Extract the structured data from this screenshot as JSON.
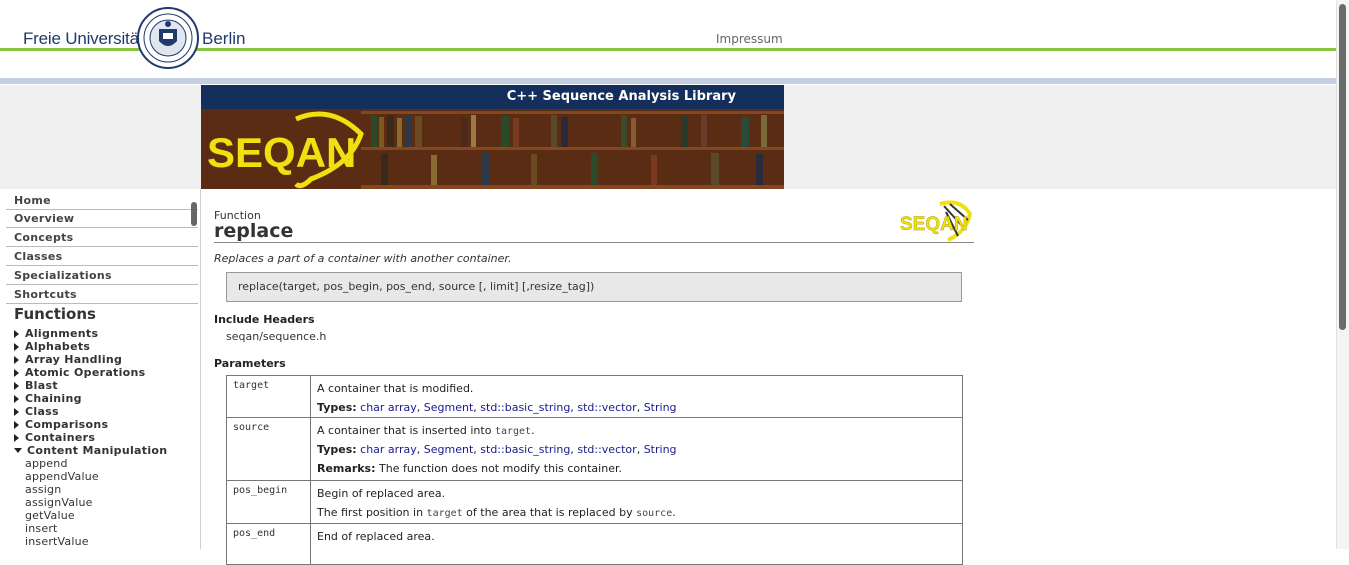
{
  "fu": {
    "name_left": "Freie Universität",
    "name_right": "Berlin",
    "impressum": "Impressum"
  },
  "banner": {
    "title": "C++ Sequence Analysis Library",
    "logo_text": "SEQAN"
  },
  "nav": {
    "items": [
      "Home",
      "Overview",
      "Concepts",
      "Classes",
      "Specializations",
      "Shortcuts"
    ],
    "functions_title": "Functions",
    "categories": [
      "Alignments",
      "Alphabets",
      "Array Handling",
      "Atomic Operations",
      "Blast",
      "Chaining",
      "Class",
      "Comparisons",
      "Containers",
      "Content Manipulation"
    ],
    "expanded_items": [
      "append",
      "appendValue",
      "assign",
      "assignValue",
      "getValue",
      "insert",
      "insertValue"
    ]
  },
  "doc": {
    "kind": "Function",
    "name": "replace",
    "summary": "Replaces a part of a container with another container.",
    "signature": "replace(target, pos_begin, pos_end, source [, limit] [,resize_tag])",
    "include_heading": "Include Headers",
    "include_file": "seqan/sequence.h",
    "params_heading": "Parameters",
    "types_label": "Types:",
    "remarks_label": "Remarks:",
    "type_links": [
      "char array",
      "Segment",
      "std::basic_string",
      "std::vector",
      "String"
    ],
    "params": [
      {
        "name": "target",
        "desc": "A container that is modified."
      },
      {
        "name": "source",
        "desc_pre": "A container that is inserted into",
        "desc_code": "target",
        "desc_post": ".",
        "remarks": "The function does not modify this container."
      },
      {
        "name": "pos_begin",
        "desc": "Begin of replaced area.",
        "detail_pre": "The first position in",
        "detail_code1": "target",
        "detail_mid": "of the area that is replaced by",
        "detail_code2": "source",
        "detail_post": "."
      },
      {
        "name": "pos_end",
        "desc": "End of replaced area."
      }
    ]
  },
  "colors": {
    "fu_blue": "#1f3a6b",
    "fu_green": "#8ac43f",
    "banner_navy": "#142f5c",
    "logo_yellow": "#f0e010",
    "link": "#1a1a8e"
  }
}
